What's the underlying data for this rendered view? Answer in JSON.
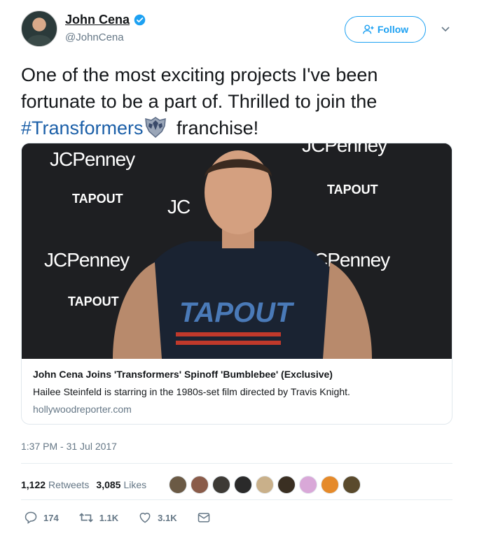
{
  "author": {
    "name": "John Cena",
    "handle": "@JohnCena",
    "verified_icon": "verified-badge-icon"
  },
  "follow_button": {
    "label": "Follow"
  },
  "tweet": {
    "text_part1": "One of the most exciting projects I've been fortunate to be a part of. Thrilled to join the ",
    "hashtag": "#Transformers",
    "text_part2": " franchise!"
  },
  "card": {
    "image_logos": {
      "jcp1": "JCPenney",
      "jcp2": "JC",
      "jcp3": "JCPenney",
      "jcp4": "JCPenney",
      "jcp_top": "JCPenney",
      "tapout": "TAPOUT",
      "shirt": "TAPOUT"
    },
    "title": "John Cena Joins 'Transformers' Spinoff 'Bumblebee' (Exclusive)",
    "description": "Hailee Steinfeld is starring in the 1980s-set film directed by Travis Knight.",
    "domain": "hollywoodreporter.com"
  },
  "timestamp": "1:37 PM - 31 Jul 2017",
  "stats": {
    "retweets_count": "1,122",
    "retweets_label": "Retweets",
    "likes_count": "3,085",
    "likes_label": "Likes",
    "liker_colors": [
      "#6b5a45",
      "#8a5c4a",
      "#3d3a35",
      "#2a2a2a",
      "#c9b08a",
      "#3a2f22",
      "#d9a8d8",
      "#e58a2a",
      "#5a4a2c"
    ]
  },
  "actions": {
    "replies": "174",
    "retweets": "1.1K",
    "likes": "3.1K"
  },
  "colors": {
    "accent": "#1da1f2",
    "hashtag": "#1b5fa8",
    "muted": "#657786"
  }
}
